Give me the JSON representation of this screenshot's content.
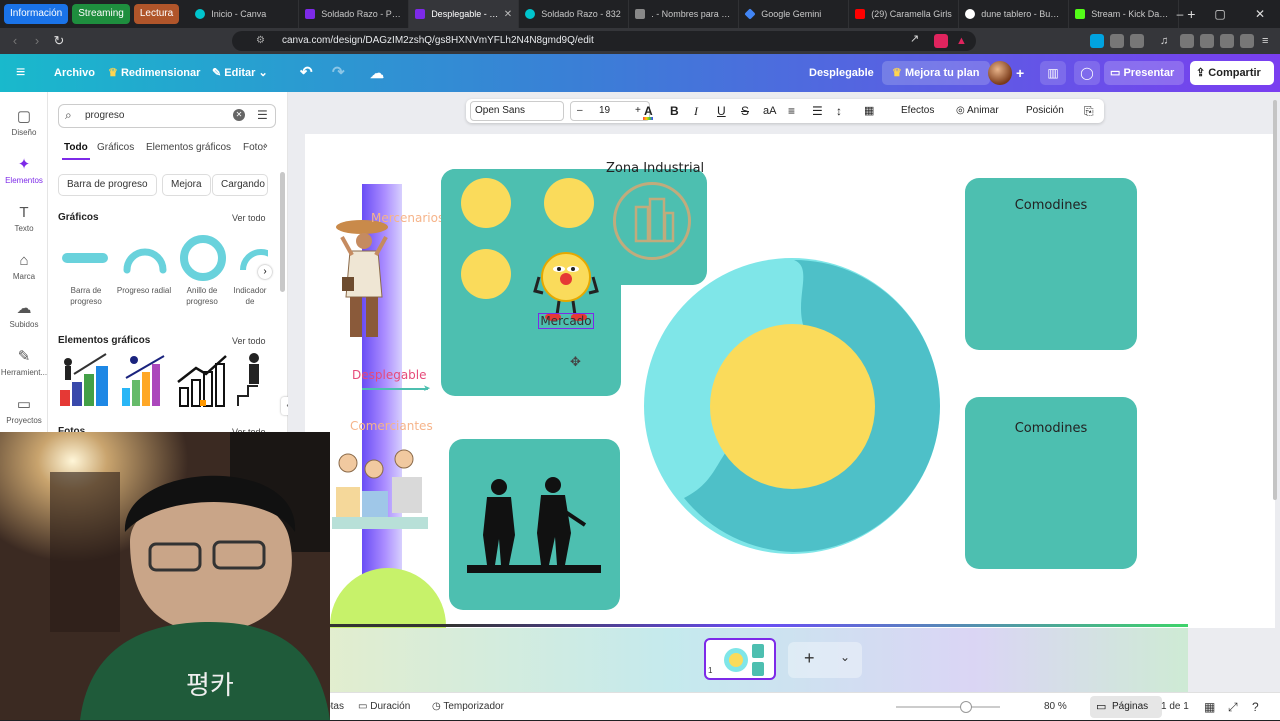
{
  "browser": {
    "groups": [
      {
        "label": "Información",
        "color": "#1a73e8"
      },
      {
        "label": "Streaming",
        "color": "#1e8e3e"
      },
      {
        "label": "Lectura",
        "color": "#b0552a"
      }
    ],
    "tabs": [
      {
        "title": "Inicio - Canva",
        "fav": "#00c4cc",
        "active": false
      },
      {
        "title": "Soldado Razo - Pizarr",
        "fav": "#7d2ae8",
        "active": false
      },
      {
        "title": "Desplegable - Pizarr",
        "fav": "#7d2ae8",
        "active": true
      },
      {
        "title": "Soldado Razo - 832",
        "fav": "#00c4cc",
        "active": false
      },
      {
        "title": ". - Nombres para fas",
        "fav": "#888888",
        "active": false
      },
      {
        "title": "Google Gemini",
        "fav": "#4285f4",
        "active": false
      },
      {
        "title": "(29) Caramella Girls",
        "fav": "#ff0000",
        "active": false
      },
      {
        "title": "dune tablero - Busca",
        "fav": "#ffffff",
        "active": false
      },
      {
        "title": "Stream - Kick Dashbo",
        "fav": "#53fc18",
        "active": false
      }
    ],
    "url": "canva.com/design/DAGzIM2zshQ/gs8HXNVmYFLh2N4N8gmd9Q/edit"
  },
  "canva": {
    "menu": {
      "file": "Archivo",
      "resize": "Redimensionar",
      "edit": "Editar"
    },
    "doc_title": "Desplegable",
    "upgrade": "Mejora tu plan",
    "present": "Presentar",
    "share": "Compartir"
  },
  "rail": [
    {
      "label": "Diseño",
      "icon": "design-icon",
      "glyph": "▢"
    },
    {
      "label": "Elementos",
      "icon": "elements-icon",
      "glyph": "✦",
      "active": true
    },
    {
      "label": "Texto",
      "icon": "text-icon",
      "glyph": "T"
    },
    {
      "label": "Marca",
      "icon": "brand-icon",
      "glyph": "⌂"
    },
    {
      "label": "Subidos",
      "icon": "uploads-icon",
      "glyph": "☁"
    },
    {
      "label": "Herramient...",
      "icon": "tools-icon",
      "glyph": "✎"
    },
    {
      "label": "Proyectos",
      "icon": "projects-icon",
      "glyph": "▭"
    }
  ],
  "panel": {
    "search_value": "progreso",
    "tabs": [
      "Todo",
      "Gráficos",
      "Elementos gráficos",
      "Fotos"
    ],
    "chips": [
      "Barra de progreso",
      "Mejora",
      "Cargando"
    ],
    "graphics_title": "Gráficos",
    "elements_title": "Elementos gráficos",
    "photos_title": "Fotos",
    "see_all": "Ver todo",
    "graphics": [
      "Barra de progreso",
      "Progreso radial",
      "Anillo de progreso",
      "Indicador de progreso"
    ]
  },
  "toolbar": {
    "font": "Open Sans",
    "size": "19",
    "effects": "Efectos",
    "animate": "Animar",
    "position": "Posición"
  },
  "canvas": {
    "zona": "Zona Industrial",
    "mercenarios": "Mercenarios",
    "mercado": "Mercado",
    "desplegable": "Desplegable",
    "comerciantes": "Comerciantes",
    "comodines_1": "Comodines",
    "comodines_2": "Comodines"
  },
  "status": {
    "notes": "Notas",
    "duration": "Duración",
    "timer": "Temporizador",
    "zoom": "80 %",
    "pages": "Páginas",
    "page_count": "1 de 1",
    "thumb_number": "1"
  }
}
